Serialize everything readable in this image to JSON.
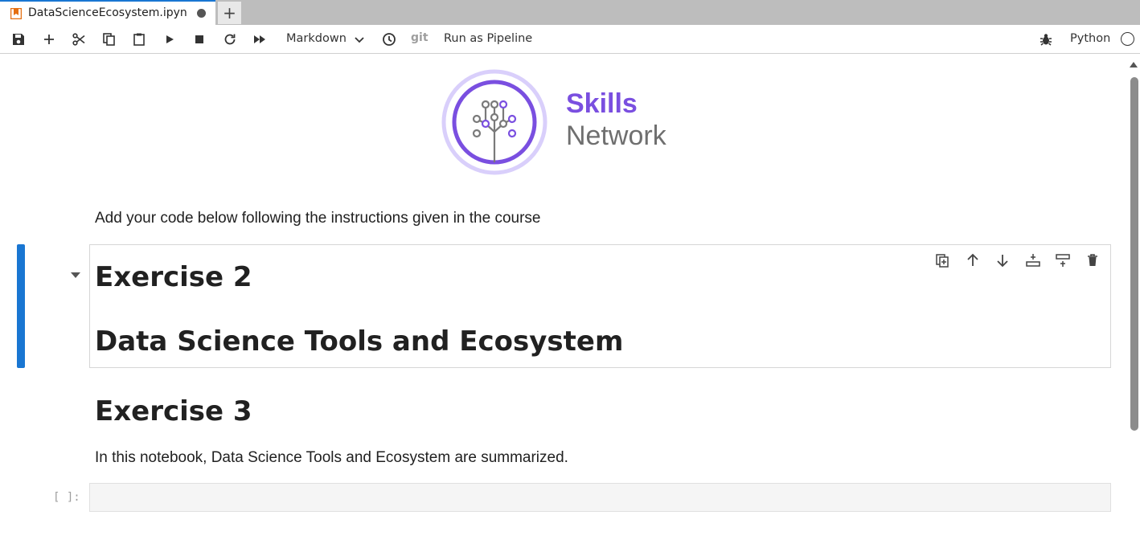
{
  "tab": {
    "title": "DataScienceEcosystem.ipyn",
    "new_tab_label": "+"
  },
  "toolbar": {
    "cell_type": "Markdown",
    "git_label": "git",
    "run_pipeline": "Run as Pipeline",
    "kernel_name": "Python"
  },
  "logo": {
    "line1": "Skills",
    "line2": "Network"
  },
  "notebook": {
    "intro_text": "Add your code below following the instructions given in the course",
    "active_cell": {
      "heading1": "Exercise 2",
      "heading2": "Data Science Tools and Ecosystem"
    },
    "heading3": "Exercise 3",
    "summary_text": "In this notebook, Data Science Tools and Ecosystem are summarized.",
    "code_prompt": "[ ]:"
  },
  "colors": {
    "accent": "#1976d2",
    "brand_purple": "#7a4fe0",
    "brand_gray": "#6f6f6f"
  }
}
